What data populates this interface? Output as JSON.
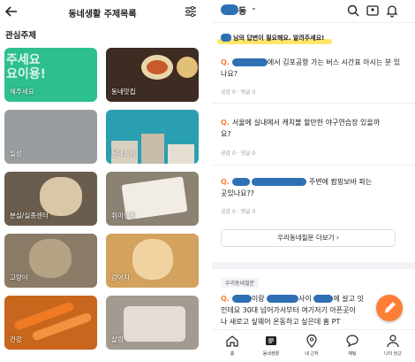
{
  "left": {
    "title": "동네생활 주제목록",
    "section_label": "관심주제",
    "tiles": [
      {
        "label": "해주세요",
        "art_text": "주세요\n요이용!"
      },
      {
        "label": "동네맛집"
      },
      {
        "label": "일상"
      },
      {
        "label": "동네소식"
      },
      {
        "label": "분실/실종센터"
      },
      {
        "label": "취미생활"
      },
      {
        "label": "고양이"
      },
      {
        "label": "강아지"
      },
      {
        "label": "건강"
      },
      {
        "label": "살림"
      }
    ]
  },
  "right": {
    "location_suffix": "동",
    "banner": "님의 답변이 필요해요. 알려주세요!",
    "questions": [
      {
        "marker": "Q.",
        "line1": "에서 김포공항 가는 버스 시간표 아시는 분 있",
        "line2": "나요?",
        "meta": "공감 0 · 댓글 0"
      },
      {
        "marker": "Q.",
        "line1": "서울에 실내에서 캐치볼 할만한 야구연습장 있을까",
        "line2": "요?",
        "meta": "공감 0 · 댓글 0"
      },
      {
        "marker": "Q.",
        "line1": "주변에 팝핑보바 파는",
        "line2": "곳있나요??",
        "meta": "공감 0 · 댓글 0"
      }
    ],
    "more_button": "우리동네질문 더보기",
    "tag": "우리동네질문",
    "partial_question": {
      "marker": "Q.",
      "line1_a": "이랑",
      "line1_b": "사이",
      "line1_c": "에 살고 잇",
      "line2": "인데요 30대 넘어가서부터 여기저기 아픈곳이",
      "line3": "나 새로고 싶웨어 온동하고 싶은데 홈 PT"
    },
    "nav": [
      {
        "label": "홈",
        "icon": "home-icon"
      },
      {
        "label": "동네생활",
        "icon": "newspaper-icon"
      },
      {
        "label": "내 근처",
        "icon": "location-icon"
      },
      {
        "label": "채팅",
        "icon": "chat-icon"
      },
      {
        "label": "나의 당근",
        "icon": "person-icon"
      }
    ]
  },
  "colors": {
    "accent": "#ff7e36",
    "highlight": "#ffe76b",
    "redaction": "#2f6fb4"
  }
}
